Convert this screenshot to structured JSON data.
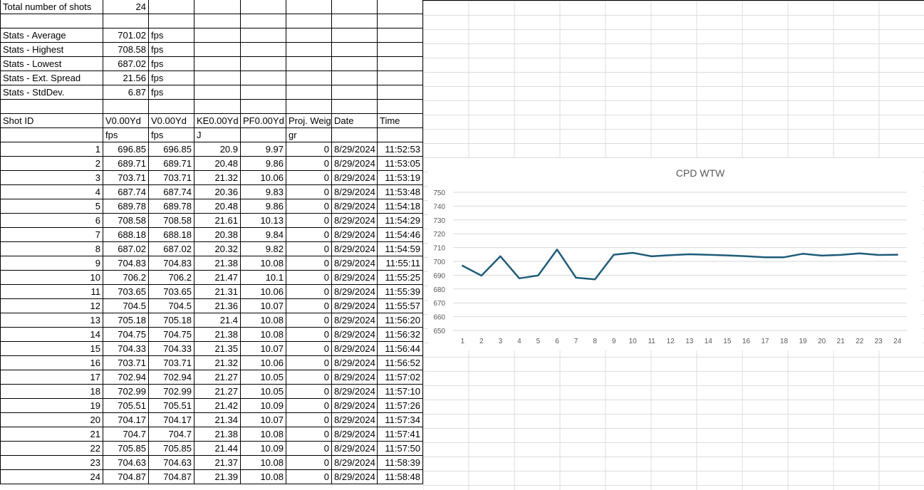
{
  "summary": [
    {
      "label": "Total number of shots",
      "value": "24",
      "unit": ""
    },
    {
      "label": "Stats - Average",
      "value": "701.02",
      "unit": "fps"
    },
    {
      "label": "Stats - Highest",
      "value": "708.58",
      "unit": "fps"
    },
    {
      "label": "Stats - Lowest",
      "value": "687.02",
      "unit": "fps"
    },
    {
      "label": "Stats - Ext. Spread",
      "value": "21.56",
      "unit": "fps"
    },
    {
      "label": "Stats - StdDev.",
      "value": "6.87",
      "unit": "fps"
    }
  ],
  "headers": [
    "Shot ID",
    "V0.00Yd",
    "V0.00Yd",
    "KE0.00Yd",
    "PF0.00Yd",
    "Proj. Weig",
    "Date",
    "Time"
  ],
  "units": [
    "",
    "fps",
    "fps",
    "J",
    "",
    "gr",
    "",
    ""
  ],
  "rows": [
    [
      "1",
      "696.85",
      "696.85",
      "20.9",
      "9.97",
      "0",
      "8/29/2024",
      "11:52:53"
    ],
    [
      "2",
      "689.71",
      "689.71",
      "20.48",
      "9.86",
      "0",
      "8/29/2024",
      "11:53:05"
    ],
    [
      "3",
      "703.71",
      "703.71",
      "21.32",
      "10.06",
      "0",
      "8/29/2024",
      "11:53:19"
    ],
    [
      "4",
      "687.74",
      "687.74",
      "20.36",
      "9.83",
      "0",
      "8/29/2024",
      "11:53:48"
    ],
    [
      "5",
      "689.78",
      "689.78",
      "20.48",
      "9.86",
      "0",
      "8/29/2024",
      "11:54:18"
    ],
    [
      "6",
      "708.58",
      "708.58",
      "21.61",
      "10.13",
      "0",
      "8/29/2024",
      "11:54:29"
    ],
    [
      "7",
      "688.18",
      "688.18",
      "20.38",
      "9.84",
      "0",
      "8/29/2024",
      "11:54:46"
    ],
    [
      "8",
      "687.02",
      "687.02",
      "20.32",
      "9.82",
      "0",
      "8/29/2024",
      "11:54:59"
    ],
    [
      "9",
      "704.83",
      "704.83",
      "21.38",
      "10.08",
      "0",
      "8/29/2024",
      "11:55:11"
    ],
    [
      "10",
      "706.2",
      "706.2",
      "21.47",
      "10.1",
      "0",
      "8/29/2024",
      "11:55:25"
    ],
    [
      "11",
      "703.65",
      "703.65",
      "21.31",
      "10.06",
      "0",
      "8/29/2024",
      "11:55:39"
    ],
    [
      "12",
      "704.5",
      "704.5",
      "21.36",
      "10.07",
      "0",
      "8/29/2024",
      "11:55:57"
    ],
    [
      "13",
      "705.18",
      "705.18",
      "21.4",
      "10.08",
      "0",
      "8/29/2024",
      "11:56:20"
    ],
    [
      "14",
      "704.75",
      "704.75",
      "21.38",
      "10.08",
      "0",
      "8/29/2024",
      "11:56:32"
    ],
    [
      "15",
      "704.33",
      "704.33",
      "21.35",
      "10.07",
      "0",
      "8/29/2024",
      "11:56:44"
    ],
    [
      "16",
      "703.71",
      "703.71",
      "21.32",
      "10.06",
      "0",
      "8/29/2024",
      "11:56:52"
    ],
    [
      "17",
      "702.94",
      "702.94",
      "21.27",
      "10.05",
      "0",
      "8/29/2024",
      "11:57:02"
    ],
    [
      "18",
      "702.99",
      "702.99",
      "21.27",
      "10.05",
      "0",
      "8/29/2024",
      "11:57:10"
    ],
    [
      "19",
      "705.51",
      "705.51",
      "21.42",
      "10.09",
      "0",
      "8/29/2024",
      "11:57:26"
    ],
    [
      "20",
      "704.17",
      "704.17",
      "21.34",
      "10.07",
      "0",
      "8/29/2024",
      "11:57:34"
    ],
    [
      "21",
      "704.7",
      "704.7",
      "21.38",
      "10.08",
      "0",
      "8/29/2024",
      "11:57:41"
    ],
    [
      "22",
      "705.85",
      "705.85",
      "21.44",
      "10.09",
      "0",
      "8/29/2024",
      "11:57:50"
    ],
    [
      "23",
      "704.63",
      "704.63",
      "21.37",
      "10.08",
      "0",
      "8/29/2024",
      "11:58:39"
    ],
    [
      "24",
      "704.87",
      "704.87",
      "21.39",
      "10.08",
      "0",
      "8/29/2024",
      "11:58:48"
    ]
  ],
  "chart_data": {
    "type": "line",
    "title": "CPD WTW",
    "x": [
      1,
      2,
      3,
      4,
      5,
      6,
      7,
      8,
      9,
      10,
      11,
      12,
      13,
      14,
      15,
      16,
      17,
      18,
      19,
      20,
      21,
      22,
      23,
      24
    ],
    "series": [
      {
        "values": [
          696.85,
          689.71,
          703.71,
          687.74,
          689.78,
          708.58,
          688.18,
          687.02,
          704.83,
          706.2,
          703.65,
          704.5,
          705.18,
          704.75,
          704.33,
          703.71,
          702.94,
          702.99,
          705.51,
          704.17,
          704.7,
          705.85,
          704.63,
          704.87
        ]
      }
    ],
    "yticks": [
      650,
      660,
      670,
      680,
      690,
      700,
      710,
      720,
      730,
      740,
      750
    ],
    "ylim": [
      650,
      750
    ],
    "grid": true,
    "legend": "none",
    "line_color": "#1f5c7a"
  }
}
